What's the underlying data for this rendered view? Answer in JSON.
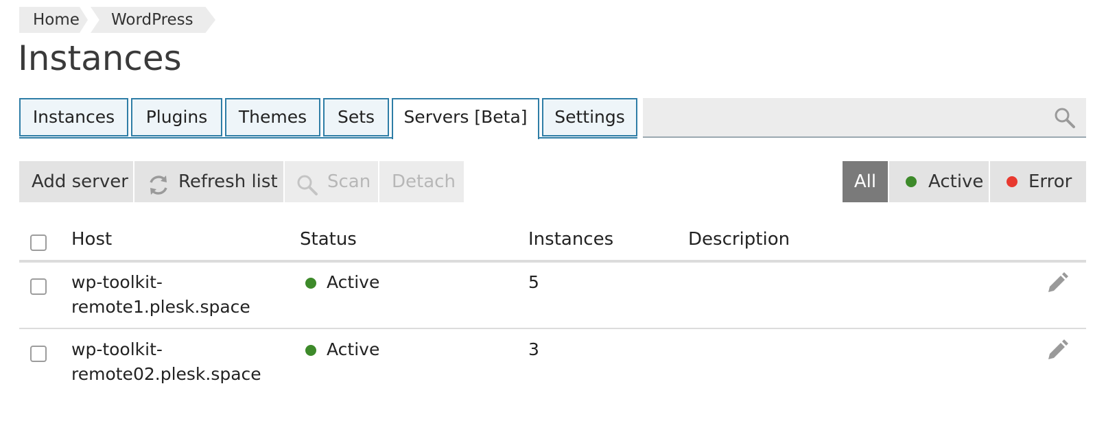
{
  "breadcrumb": [
    "Home",
    "WordPress"
  ],
  "page_title": "Instances",
  "tabs": [
    {
      "label": "Instances",
      "active": false
    },
    {
      "label": "Plugins",
      "active": false
    },
    {
      "label": "Themes",
      "active": false
    },
    {
      "label": "Sets",
      "active": false
    },
    {
      "label": "Servers [Beta]",
      "active": true
    },
    {
      "label": "Settings",
      "active": false
    }
  ],
  "search": {
    "placeholder": "",
    "icon": "search-icon"
  },
  "toolbar": {
    "add_server": "Add server",
    "refresh_list": "Refresh list",
    "scan": "Scan",
    "detach": "Detach"
  },
  "filters": {
    "all": "All",
    "active": "Active",
    "error": "Error",
    "selected": "All"
  },
  "table": {
    "headers": {
      "host": "Host",
      "status": "Status",
      "instances": "Instances",
      "description": "Description"
    },
    "rows": [
      {
        "host": "wp-toolkit-\nremote1.plesk.space",
        "status": "Active",
        "instances": "5",
        "description": ""
      },
      {
        "host": "wp-toolkit-\nremote02.plesk.space",
        "status": "Active",
        "instances": "3",
        "description": ""
      }
    ]
  },
  "colors": {
    "accent": "#2e7da6",
    "active": "#3d8a2a",
    "error": "#e8392f",
    "filter_selected": "#7a7a7a"
  }
}
